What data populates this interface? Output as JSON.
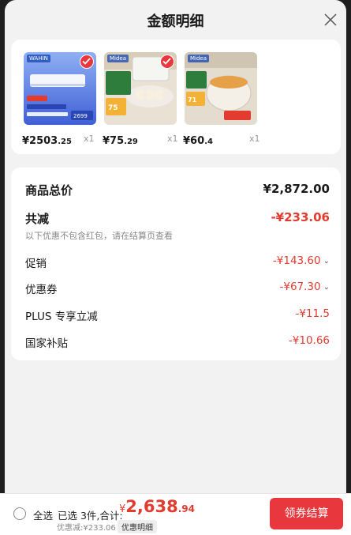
{
  "header": {
    "title": "金额明细"
  },
  "products": [
    {
      "brand": "WAHIN",
      "price_int": "¥2503",
      "price_dec": ".25",
      "qty": "x1"
    },
    {
      "brand": "Midea",
      "price_int": "¥75",
      "price_dec": ".29",
      "qty": "x1"
    },
    {
      "brand": "Midea",
      "price_int": "¥60",
      "price_dec": ".4",
      "qty": "x1"
    }
  ],
  "summary": {
    "total_label": "商品总价",
    "total_value": "¥2,872.00",
    "reduce_label": "共减",
    "reduce_value": "-¥233.06",
    "reduce_note": "以下优惠不包含红包，请在结算页查看",
    "items": [
      {
        "label": "促销",
        "value": "-¥143.60"
      },
      {
        "label": "优惠券",
        "value": "-¥67.30"
      },
      {
        "label": "PLUS 专享立减",
        "value": "-¥11.5"
      },
      {
        "label": "国家补贴",
        "value": "-¥10.66"
      }
    ]
  },
  "bottom": {
    "select_all": "全选",
    "selected_text": "已选 3件,合计:",
    "total_yen": "¥",
    "total_int": "2,638",
    "total_dec": ".94",
    "discount_text": "优惠减:¥233.06",
    "detail_tag": "优惠明细",
    "checkout_label": "领券结算"
  },
  "colors": {
    "accent": "#e8373d",
    "price_red": "#e33b2e"
  },
  "icons": {
    "close": "close-icon",
    "check": "check-icon",
    "chevron": "chevron-down-icon"
  }
}
